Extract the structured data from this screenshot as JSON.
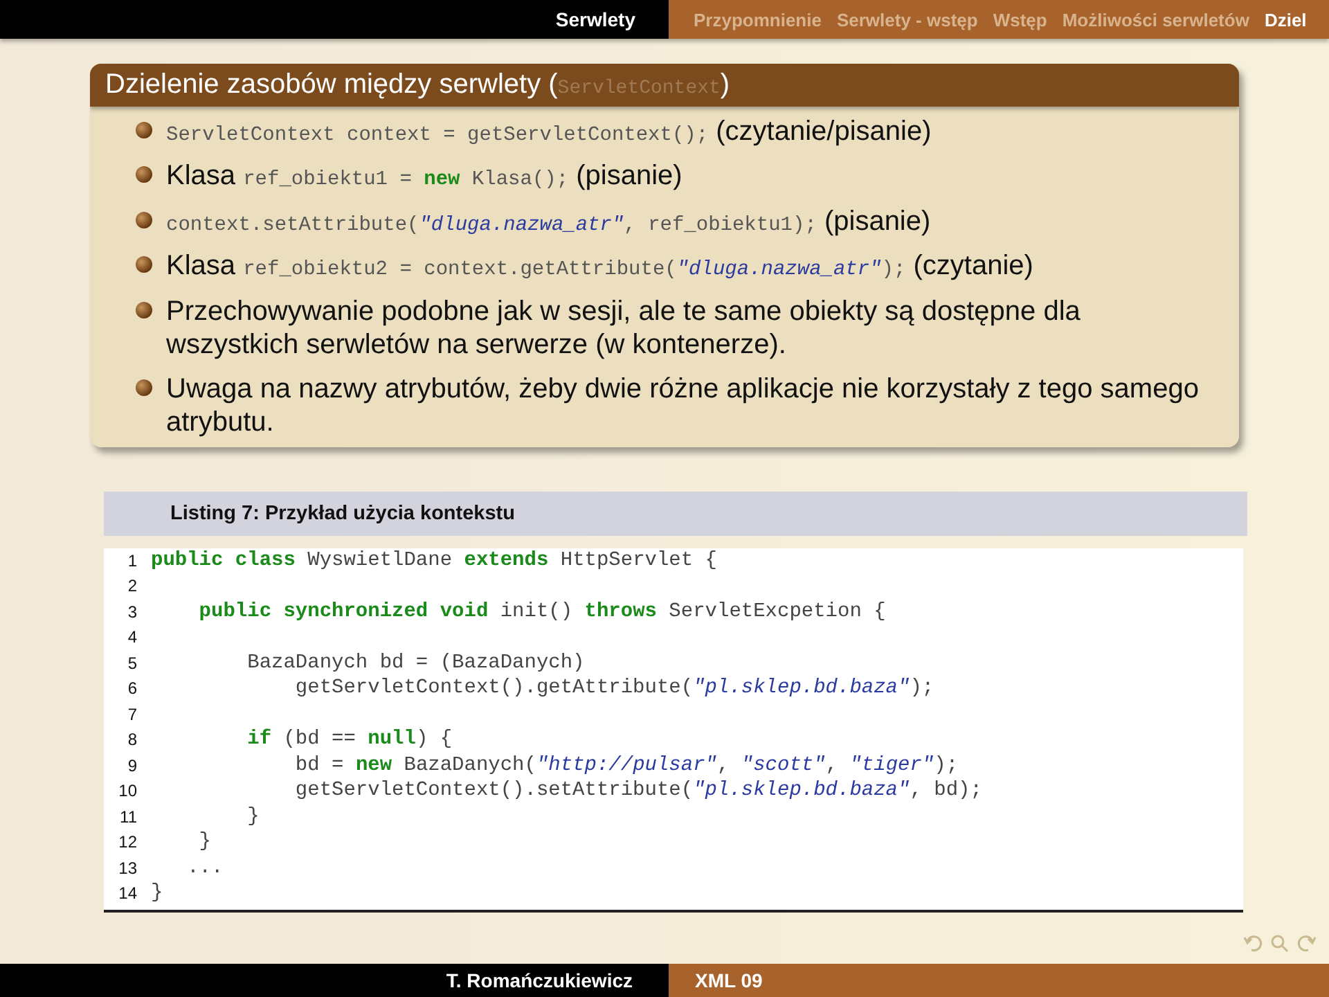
{
  "header": {
    "section": "Serwlety",
    "nav": [
      {
        "label": "Przypomnienie",
        "selected": false
      },
      {
        "label": "Serwlety - wstęp",
        "selected": false
      },
      {
        "label": "Wstęp",
        "selected": false
      },
      {
        "label": "Możliwości serwletów",
        "selected": false
      },
      {
        "label": "Dziel",
        "selected": true
      }
    ]
  },
  "block": {
    "title": [
      {
        "kind": "text",
        "text": "Dzielenie zasobów między serwlety ("
      },
      {
        "kind": "code",
        "text": "ServletContext"
      },
      {
        "kind": "text",
        "text": ")"
      }
    ],
    "bullets": [
      [
        {
          "kind": "code",
          "text": "ServletContext context = getServletContext();"
        },
        {
          "kind": "text",
          "text": " (czytanie/pisanie)"
        }
      ],
      [
        {
          "kind": "text",
          "text": "Klasa "
        },
        {
          "kind": "code",
          "text": "ref_obiektu1 = "
        },
        {
          "kind": "keyword",
          "text": "new"
        },
        {
          "kind": "code",
          "text": " Klasa();"
        },
        {
          "kind": "text",
          "text": " (pisanie)"
        }
      ],
      [
        {
          "kind": "code",
          "text": "context.setAttribute("
        },
        {
          "kind": "string",
          "text": "\"dluga.nazwa_atr\""
        },
        {
          "kind": "code",
          "text": ", ref_obiektu1);"
        },
        {
          "kind": "text",
          "text": " (pisanie)"
        }
      ],
      [
        {
          "kind": "text",
          "text": "Klasa "
        },
        {
          "kind": "code",
          "text": "ref_obiektu2 = context.getAttribute("
        },
        {
          "kind": "string",
          "text": "\"dluga.nazwa_atr\""
        },
        {
          "kind": "code",
          "text": ");"
        },
        {
          "kind": "text",
          "text": " (czytanie)"
        }
      ],
      [
        {
          "kind": "text",
          "text": "Przechowywanie podobne jak w sesji, ale te same obiekty są dostępne dla wszystkich serwletów na serwerze (w kontenerze)."
        }
      ],
      [
        {
          "kind": "text",
          "text": "Uwaga na nazwy atrybutów, żeby dwie różne aplikacje nie korzystały z tego samego atrybutu."
        }
      ]
    ]
  },
  "listing": {
    "caption": "Listing 7: Przykład użycia kontekstu",
    "lines": [
      {
        "number": "1",
        "tokens": [
          {
            "kind": "keyword",
            "text": "public class"
          },
          {
            "kind": "code",
            "text": " WyswietlDane "
          },
          {
            "kind": "keyword",
            "text": "extends"
          },
          {
            "kind": "code",
            "text": " HttpServlet {"
          }
        ]
      },
      {
        "number": "2"
      },
      {
        "number": "3",
        "tokens": [
          {
            "kind": "keyword",
            "text": "    public synchronized void"
          },
          {
            "kind": "code",
            "text": " init() "
          },
          {
            "kind": "keyword",
            "text": "throws"
          },
          {
            "kind": "code",
            "text": " ServletExcpetion {"
          }
        ]
      },
      {
        "number": "4"
      },
      {
        "number": "5",
        "tokens": [
          {
            "kind": "code",
            "text": "        BazaDanych bd = (BazaDanych)"
          }
        ]
      },
      {
        "number": "6",
        "tokens": [
          {
            "kind": "code",
            "text": "            getServletContext().getAttribute("
          },
          {
            "kind": "string",
            "text": "\"pl.sklep.bd.baza\""
          },
          {
            "kind": "code",
            "text": ");"
          }
        ]
      },
      {
        "number": "7"
      },
      {
        "number": "8",
        "tokens": [
          {
            "kind": "keyword",
            "text": "        if"
          },
          {
            "kind": "code",
            "text": " (bd == "
          },
          {
            "kind": "keyword",
            "text": "null"
          },
          {
            "kind": "code",
            "text": ") {"
          }
        ]
      },
      {
        "number": "9",
        "tokens": [
          {
            "kind": "code",
            "text": "            bd = "
          },
          {
            "kind": "keyword",
            "text": "new"
          },
          {
            "kind": "code",
            "text": " BazaDanych("
          },
          {
            "kind": "string",
            "text": "\"http://pulsar\""
          },
          {
            "kind": "code",
            "text": ", "
          },
          {
            "kind": "string",
            "text": "\"scott\""
          },
          {
            "kind": "code",
            "text": ", "
          },
          {
            "kind": "string",
            "text": "\"tiger\""
          },
          {
            "kind": "code",
            "text": ");"
          }
        ]
      },
      {
        "number": "10",
        "tokens": [
          {
            "kind": "code",
            "text": "            getServletContext().setAttribute("
          },
          {
            "kind": "string",
            "text": "\"pl.sklep.bd.baza\""
          },
          {
            "kind": "code",
            "text": ", bd);"
          }
        ]
      },
      {
        "number": "11",
        "tokens": [
          {
            "kind": "code",
            "text": "        }"
          }
        ]
      },
      {
        "number": "12",
        "tokens": [
          {
            "kind": "code",
            "text": "    }"
          }
        ]
      },
      {
        "number": "13",
        "tokens": [
          {
            "kind": "code",
            "text": "   ..."
          }
        ]
      },
      {
        "number": "14",
        "tokens": [
          {
            "kind": "code",
            "text": "}"
          }
        ]
      }
    ]
  },
  "footer": {
    "author": "T. Romańczukiewicz",
    "title": "XML 09"
  }
}
